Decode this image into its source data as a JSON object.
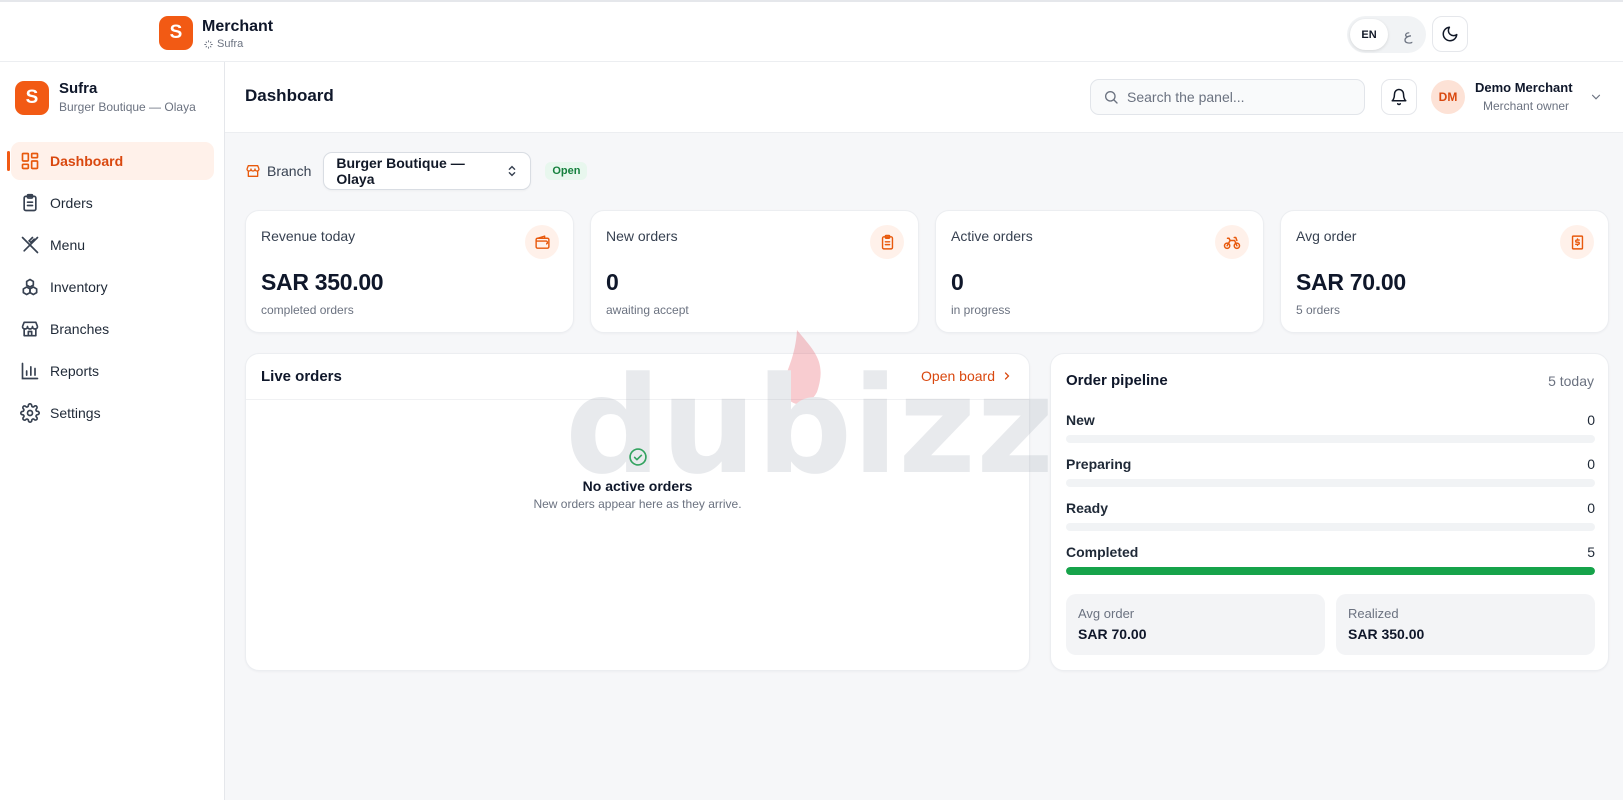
{
  "topbar": {
    "logo_letter": "S",
    "title": "Merchant",
    "subtitle": "Sufra",
    "lang_en": "EN",
    "lang_ar": "ع"
  },
  "sidebar": {
    "logo_letter": "S",
    "brand": "Sufra",
    "branch": "Burger Boutique — Olaya",
    "items": [
      {
        "label": "Dashboard",
        "icon": "dashboard-icon",
        "active": true
      },
      {
        "label": "Orders",
        "icon": "clipboard-icon"
      },
      {
        "label": "Menu",
        "icon": "utensils-icon"
      },
      {
        "label": "Inventory",
        "icon": "boxes-icon"
      },
      {
        "label": "Branches",
        "icon": "store-icon"
      },
      {
        "label": "Reports",
        "icon": "bar-chart-icon"
      },
      {
        "label": "Settings",
        "icon": "gear-icon"
      }
    ]
  },
  "header": {
    "title": "Dashboard",
    "search_placeholder": "Search the panel...",
    "user": {
      "initials": "DM",
      "name": "Demo Merchant",
      "role": "Merchant owner"
    }
  },
  "branch_bar": {
    "label": "Branch",
    "selected": "Burger Boutique — Olaya",
    "status": "Open"
  },
  "stats": [
    {
      "label": "Revenue today",
      "value": "SAR 350.00",
      "sub": "completed orders",
      "icon": "wallet-icon"
    },
    {
      "label": "New orders",
      "value": "0",
      "sub": "awaiting accept",
      "icon": "clipboard-icon"
    },
    {
      "label": "Active orders",
      "value": "0",
      "sub": "in progress",
      "icon": "bike-icon"
    },
    {
      "label": "Avg order",
      "value": "SAR 70.00",
      "sub": "5 orders",
      "icon": "receipt-icon"
    }
  ],
  "live_orders": {
    "title": "Live orders",
    "link": "Open board",
    "empty_title": "No active orders",
    "empty_sub": "New orders appear here as they arrive."
  },
  "pipeline": {
    "title": "Order pipeline",
    "count": "5 today",
    "stages": [
      {
        "name": "New",
        "value": "0",
        "fraction": 0
      },
      {
        "name": "Preparing",
        "value": "0",
        "fraction": 0
      },
      {
        "name": "Ready",
        "value": "0",
        "fraction": 0
      },
      {
        "name": "Completed",
        "value": "5",
        "fraction": 1
      }
    ],
    "avg_label": "Avg order",
    "avg_value": "SAR 70.00",
    "realized_label": "Realized",
    "realized_value": "SAR 350.00"
  },
  "watermark": {
    "text": "dubizzle"
  },
  "colors": {
    "accent": "#f25a14",
    "accent_text": "#d9480f",
    "success": "#16a34a"
  }
}
